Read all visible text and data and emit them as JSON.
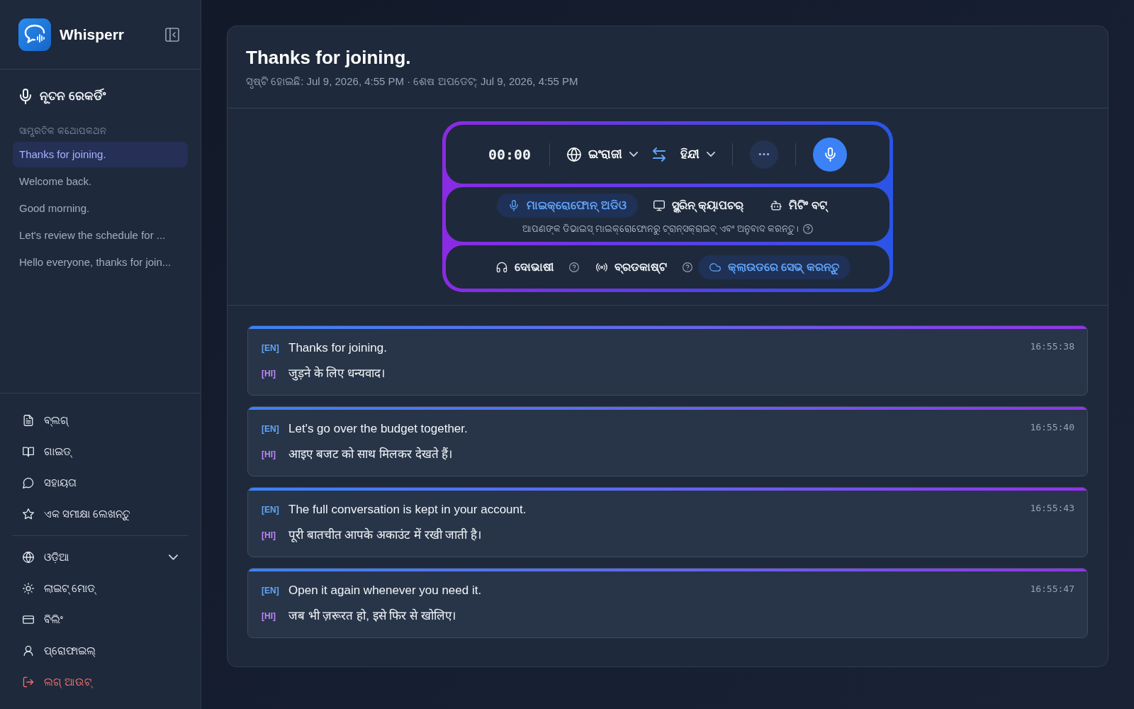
{
  "sidebar": {
    "brand": "Whisperr",
    "new_recording": "ନୂତନ ରେକର୍ଡିଂ",
    "recent_heading": "ସାମ୍ପ୍ରତିକ କଥୋପକଥନ",
    "conversations": [
      {
        "title": "Thanks for joining.",
        "selected": true
      },
      {
        "title": "Welcome back.",
        "selected": false
      },
      {
        "title": "Good morning.",
        "selected": false
      },
      {
        "title": "Let's review the schedule for ...",
        "selected": false
      },
      {
        "title": "Hello everyone, thanks for join...",
        "selected": false
      }
    ],
    "links": [
      {
        "label": "ବ୍ଲଗ୍"
      },
      {
        "label": "ଗାଇଡ୍"
      },
      {
        "label": "ସହାୟତା"
      },
      {
        "label": "ଏକ ସମୀକ୍ଷା ଲେଖନ୍ତୁ"
      }
    ],
    "settings": [
      {
        "label": "ଓଡ଼ିଆ",
        "kind": "dropdown"
      },
      {
        "label": "ଲାଇଟ୍ ମୋଡ୍",
        "kind": "item"
      },
      {
        "label": "ବିଲିଂ",
        "kind": "item"
      },
      {
        "label": "ପ୍ରୋଫାଇଲ୍",
        "kind": "item"
      },
      {
        "label": "ଲଗ୍ ଆଉଟ୍",
        "kind": "danger"
      }
    ]
  },
  "conversation": {
    "title": "Thanks for joining.",
    "meta": "ସୃଷ୍ଟି ହୋଇଛି: Jul 9, 2026, 4:55 PM · ଶେଷ ଅପଡେଟ୍: Jul 9, 2026, 4:55 PM"
  },
  "recorder": {
    "timer": "00:00",
    "source_language": "ଇଂରାଜୀ",
    "target_language": "ହିନ୍ଦୀ",
    "input_modes": [
      {
        "label": "ମାଇକ୍ରୋଫୋନ୍ ଅଡିଓ",
        "selected": true
      },
      {
        "label": "ସ୍କ୍ରିନ୍ କ୍ୟାପଚର୍",
        "selected": false
      },
      {
        "label": "ମିଟିଂ ବଟ୍",
        "selected": false
      }
    ],
    "hint": "ଆପଣଙ୍କ ଡିଭାଇସ୍ ମାଇକ୍ରୋଫୋନରୁ ଟ୍ରାନ୍ସକ୍ରାଇବ୍ ଏବଂ ଅନୁବାଦ କରନ୍ତୁ।",
    "options": [
      {
        "label": "ଦୋଭାଷୀ",
        "on": false,
        "help": true
      },
      {
        "label": "ବ୍ରଡକାଷ୍ଟ",
        "on": false,
        "help": true
      },
      {
        "label": "କ୍ଲାଉଡରେ ସେଭ୍ କରନ୍ତୁ",
        "on": true,
        "help": false
      }
    ]
  },
  "transcript": [
    {
      "time": "16:55:38",
      "source": {
        "tag": "[EN]",
        "text": "Thanks for joining."
      },
      "translation": {
        "tag": "[HI]",
        "text": "जुड़ने के लिए धन्यवाद।"
      }
    },
    {
      "time": "16:55:40",
      "source": {
        "tag": "[EN]",
        "text": "Let's go over the budget together."
      },
      "translation": {
        "tag": "[HI]",
        "text": "आइए बजट को साथ मिलकर देखते हैं।"
      }
    },
    {
      "time": "16:55:43",
      "source": {
        "tag": "[EN]",
        "text": "The full conversation is kept in your account."
      },
      "translation": {
        "tag": "[HI]",
        "text": "पूरी बातचीत आपके अकाउंट में रखी जाती है।"
      }
    },
    {
      "time": "16:55:47",
      "source": {
        "tag": "[EN]",
        "text": "Open it again whenever you need it."
      },
      "translation": {
        "tag": "[HI]",
        "text": "जब भी ज़रूरत हो, इसे फिर से खोलिए।"
      }
    }
  ]
}
